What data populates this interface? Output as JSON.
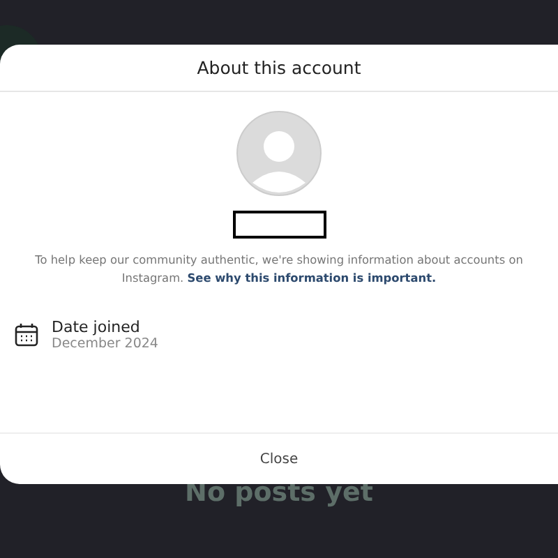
{
  "modal": {
    "title": "About this account",
    "notice": "To help keep our community authentic, we're showing information about accounts on Instagram.",
    "notice_link": "See why this information is important.",
    "details": [
      {
        "label": "Date joined",
        "value": "December 2024"
      }
    ],
    "close_button": "Close"
  },
  "background": {
    "empty_message": "No posts yet"
  }
}
